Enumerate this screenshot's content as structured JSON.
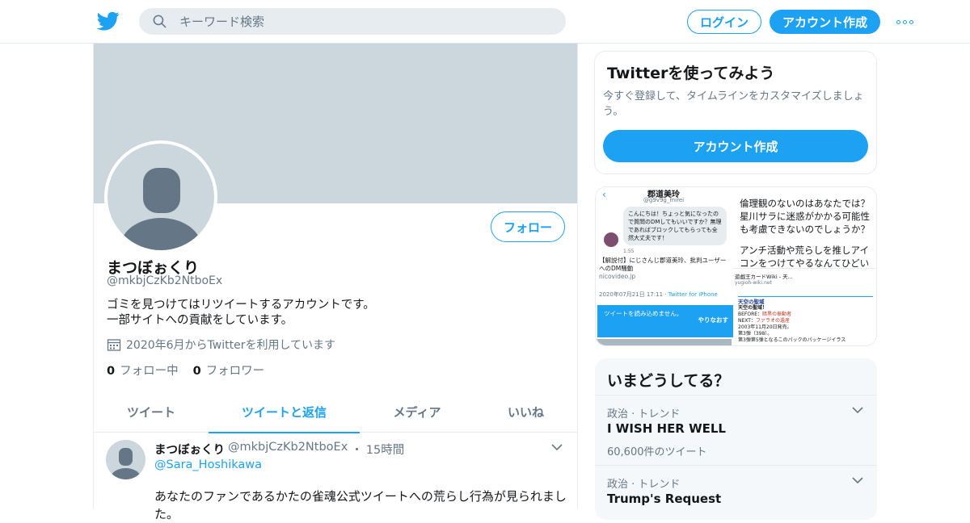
{
  "header": {
    "search_placeholder": "キーワード検索",
    "login_label": "ログイン",
    "signup_label": "アカウント作成"
  },
  "profile": {
    "display_name": "まつぼぉくり",
    "handle": "@mkbjCzKb2NtboEx",
    "bio_line1": "ゴミを見つけてはリツイートするアカウントです。",
    "bio_line2": "一部サイトへの貢献をしています。",
    "joined": "2020年6月からTwitterを利用しています",
    "following_count": "0",
    "following_label": "フォロー中",
    "followers_count": "0",
    "followers_label": "フォロワー",
    "follow_button": "フォロー"
  },
  "tabs": [
    {
      "label": "ツイート",
      "active": false
    },
    {
      "label": "ツイートと返信",
      "active": true
    },
    {
      "label": "メディア",
      "active": false
    },
    {
      "label": "いいね",
      "active": false
    }
  ],
  "tweet": {
    "name": "まつぼぉくり",
    "handle": "@mkbjCzKb2NtboEx",
    "separator": "・",
    "time": "15時間",
    "reply_to": "@Sara_Hoshikawa",
    "text": "あなたのファンであるかたの雀魂公式ツイートへの荒らし行為が見られました。"
  },
  "signup_card": {
    "title": "Twitterを使ってみよう",
    "subtitle": "今すぐ登録して、タイムラインをカスタマイズしましょう。",
    "cta": "アカウント作成"
  },
  "media_preview": {
    "left": {
      "title": "郡道美玲",
      "sub": "@g9v9g_mirei",
      "bubble": "こんにちは！ちょっと気になったので質問のDMしてもいいですか？無理であればブロックしてもらっても全然大丈夫です！",
      "time": "1:55",
      "card_title": "【解説付】にじさんじ郡道美玲、批判ユーザーへのDM騒動",
      "card_domain": "nicovideo.jp",
      "meta_date": "2020年07月21日 17:11 · ",
      "meta_app": "Twitter for iPhone",
      "cta_text": "ツイートを読み込めません。",
      "cta_retry": "やりなおす"
    },
    "right": {
      "line1": "倫理観のないのはあなたでは？星川サラに迷惑がかかる可能性も考慮できないのでしょうか？",
      "line2": "アンチ活動や荒らしを推しアイコンをつけてやるなんてひどい",
      "browser_title": "遊戯王カードWiki - 天...",
      "browser_url": "yugioh-wiki.net",
      "page_head": "天空の聖域",
      "page_box": "天空の聖域！",
      "page_before": "BEFORE：",
      "page_before_val": "暗黒の振動者",
      "page_next": "NEXT：",
      "page_next_val": "ファラオの遺産",
      "page_l1": "2003年11月20日発売。",
      "page_l2": "第3弾（398）。",
      "page_l3": "第3弾第5弾となるこのパックのパッケージイラス"
    }
  },
  "trends": {
    "title": "いまどうしてる？",
    "items": [
      {
        "meta": "政治 · トレンド",
        "name": "I WISH HER WELL",
        "count": "60,600件のツイート"
      },
      {
        "meta": "政治 · トレンド",
        "name": "Trump's Request",
        "count": ""
      }
    ]
  }
}
